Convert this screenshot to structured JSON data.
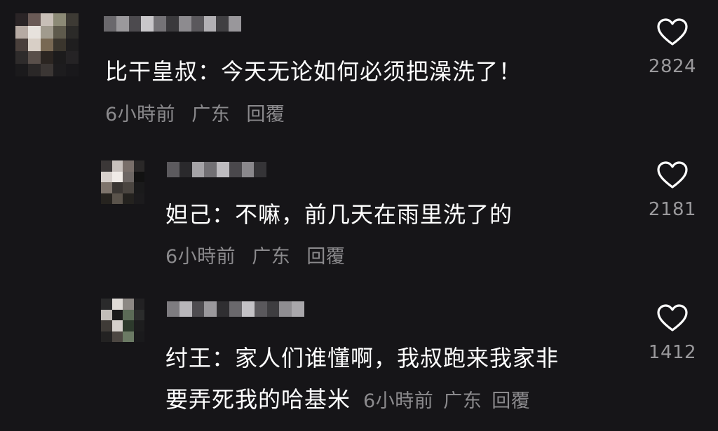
{
  "colors": {
    "background": "#161518",
    "text": "#ffffff",
    "meta": "#8b8a8d",
    "like_count": "#9a999c"
  },
  "comments": [
    {
      "text": "比干皇叔：今天无论如何必须把澡洗了！",
      "time": "6小時前",
      "location": "广东",
      "reply": "回覆",
      "likes": "2824",
      "icon": "heart-outline-icon",
      "avatar": "pixelated-avatar",
      "username": "pixelated-username"
    },
    {
      "text": "妲己：不嘛，前几天在雨里洗了的",
      "time": "6小時前",
      "location": "广东",
      "reply": "回覆",
      "likes": "2181",
      "icon": "heart-outline-icon",
      "avatar": "pixelated-avatar",
      "username": "pixelated-username"
    },
    {
      "text_line1": "纣王：家人们谁懂啊，我叔跑来我家非",
      "text_line2": "要弄死我的哈基米",
      "time": "6小時前",
      "location": "广东",
      "reply": "回覆",
      "likes": "1412",
      "icon": "heart-outline-icon",
      "avatar": "pixelated-avatar",
      "username": "pixelated-username"
    }
  ]
}
